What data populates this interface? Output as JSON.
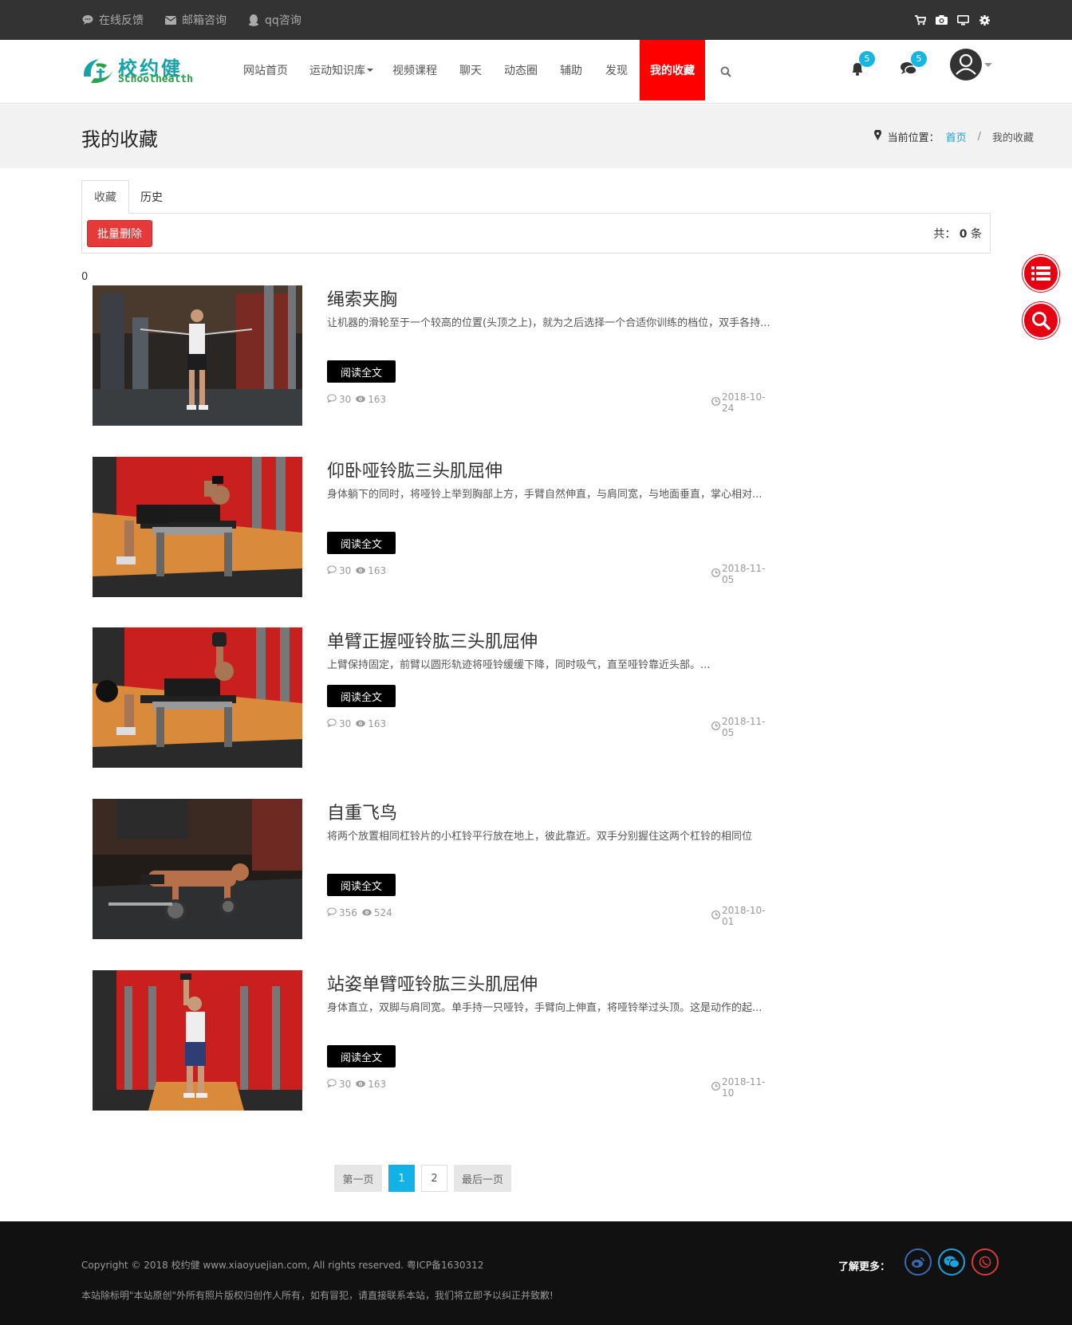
{
  "topbar": {
    "links": [
      {
        "label": "在线反馈",
        "icon": "chat-bubble-icon"
      },
      {
        "label": "邮箱咨询",
        "icon": "envelope-icon"
      },
      {
        "label": "qq咨询",
        "icon": "qq-icon"
      }
    ],
    "right_icons": [
      "cart-icon",
      "camera-icon",
      "monitor-icon",
      "gear-icon"
    ]
  },
  "header": {
    "logo_cn": "校约健",
    "logo_en": "Schoolhealth",
    "nav": [
      {
        "label": "网站首页"
      },
      {
        "label": "运动知识库"
      },
      {
        "label": "视频课程"
      },
      {
        "label": "聊天"
      },
      {
        "label": "动态圈"
      },
      {
        "label": "辅助"
      },
      {
        "label": "发现"
      },
      {
        "label": "我的收藏",
        "active": true
      }
    ],
    "notifications_count": "5",
    "messages_count": "5"
  },
  "page": {
    "title": "我的收藏",
    "breadcrumb_label": "当前位置：",
    "breadcrumb_home": "首页",
    "breadcrumb_sep": "/",
    "breadcrumb_current": "我的收藏"
  },
  "tabs": [
    {
      "label": "收藏",
      "active": true
    },
    {
      "label": "历史"
    }
  ],
  "toolbar": {
    "batch_delete": "批量删除",
    "total_prefix": "共：",
    "total_count": "0",
    "total_suffix": "条"
  },
  "stray_zero": "0",
  "articles": [
    {
      "title": "绳索夹胸",
      "summary": "让机器的滑轮至于一个较高的位置(头顶之上)，就为之后选择一个合适你训练的档位，双手各持...",
      "read": "阅读全文",
      "comments": "30",
      "views": "163",
      "date": "2018-10-24"
    },
    {
      "title": "仰卧哑铃肱三头肌屈伸",
      "summary": "身体躺下的同时，将哑铃上举到胸部上方，手臂自然伸直，与肩同宽，与地面垂直，掌心相对...",
      "read": "阅读全文",
      "comments": "30",
      "views": "163",
      "date": "2018-11-05"
    },
    {
      "title": "单臂正握哑铃肱三头肌屈伸",
      "summary": "上臂保持固定，前臂以圆形轨迹将哑铃缓缓下降，同时吸气，直至哑铃靠近头部。...",
      "read": "阅读全文",
      "comments": "30",
      "views": "163",
      "date": "2018-11-05"
    },
    {
      "title": "自重飞鸟",
      "summary": "将两个放置相同杠铃片的小杠铃平行放在地上，彼此靠近。双手分别握住这两个杠铃的相同位",
      "read": "阅读全文",
      "comments": "356",
      "views": "524",
      "date": "2018-10-01"
    },
    {
      "title": "站姿单臂哑铃肱三头肌屈伸",
      "summary": "身体直立，双脚与肩同宽。单手持一只哑铃，手臂向上伸直，将哑铃举过头顶。这是动作的起...",
      "read": "阅读全文",
      "comments": "30",
      "views": "163",
      "date": "2018-11-10"
    }
  ],
  "pagination": {
    "first": "第一页",
    "pages": [
      "1",
      "2"
    ],
    "current": "1",
    "last": "最后一页"
  },
  "footer": {
    "copyright": "Copyright © 2018 校约健 www.xiaoyuejian.com, All rights reserved. 粤ICP备1630312",
    "notice": "本站除标明\"本站原创\"外所有照片版权归创作人所有，如有冒犯，请直接联系本站，我们将立即予以纠正并致歉!",
    "learn_more": "了解更多：",
    "social": [
      "weibo-icon",
      "wechat-icon",
      "whatsapp-icon"
    ]
  },
  "colors": {
    "topbar_bg": "#333333",
    "active_nav": "#ff0000",
    "badge": "#17b5e0",
    "link": "#17a2d8",
    "danger": "#e63939",
    "page_current": "#12b1e6",
    "float_btn": "#e60012"
  }
}
